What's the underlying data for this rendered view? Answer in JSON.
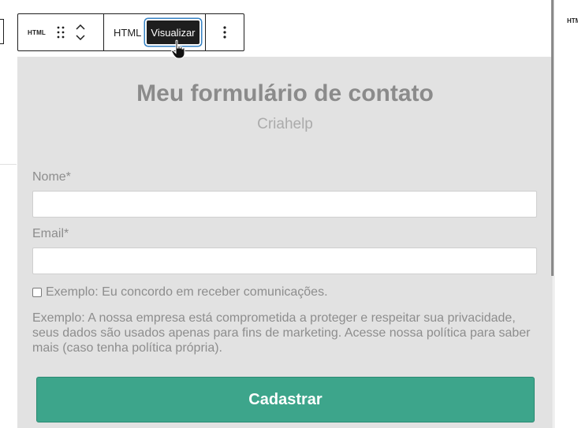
{
  "toolbar": {
    "block_type": "HTML",
    "tab_html": "HTML",
    "tab_preview": "Visualizar"
  },
  "right_block_type": "HTML",
  "form": {
    "title": "Meu formulário de contato",
    "subtitle": "Criahelp",
    "name_label": "Nome*",
    "email_label": "Email*",
    "checkbox_label": "Exemplo: Eu concordo em receber comunicações.",
    "privacy_text": "Exemplo: A nossa empresa está comprometida a proteger e respeitar sua privacidade, seus dados são usados apenas para fins de marketing. Acesse nossa política para saber mais (caso tenha política própria).",
    "submit_label": "Cadastrar"
  },
  "colors": {
    "preview_bg": "#e2e2e2",
    "submit_bg": "#3da58b",
    "focus_ring": "#3582c4"
  }
}
